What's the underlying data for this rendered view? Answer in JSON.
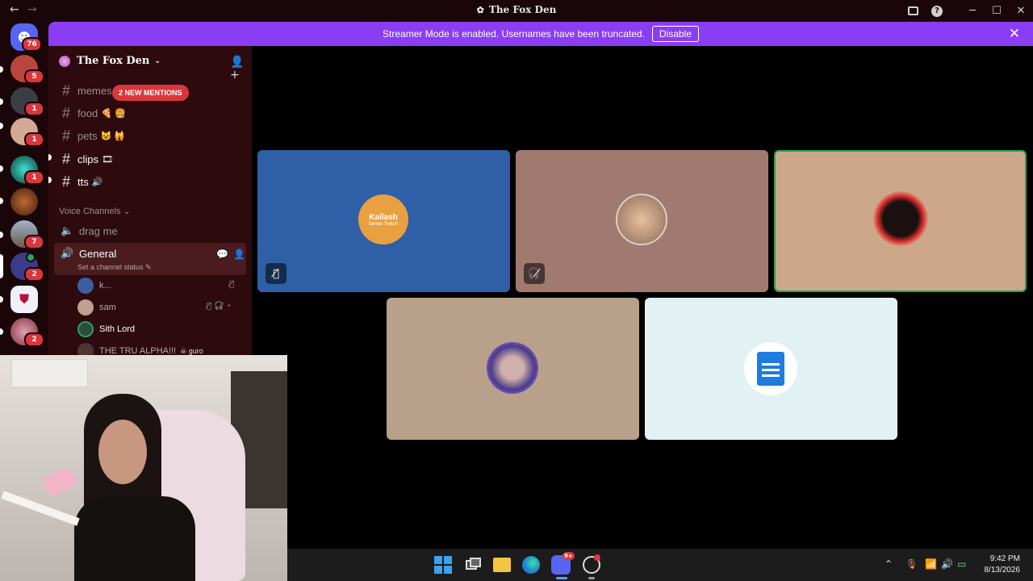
{
  "window": {
    "title": "The Fox Den",
    "back": "←",
    "forward": "→"
  },
  "banner": {
    "text": "Streamer Mode is enabled. Usernames have been truncated.",
    "button": "Disable",
    "close": "✕"
  },
  "servers": [
    {
      "badge": "76",
      "color": "#5865f2"
    },
    {
      "badge": "5",
      "color": "#b8463f"
    },
    {
      "badge": "1",
      "color": "#3a3d44"
    },
    {
      "badge": "1",
      "color": "#d4a896"
    },
    {
      "badge": "1",
      "color": "#1b6d6a"
    },
    {
      "badge": "",
      "color": "#6b3a1e"
    },
    {
      "badge": "7",
      "color": "#7b8ca1"
    },
    {
      "badge": "2",
      "color": "#3b3b8a"
    },
    {
      "badge": "",
      "color": "#e8e8f0"
    },
    {
      "badge": "2",
      "color": "#b07080"
    }
  ],
  "guild": {
    "name": "The Fox Den",
    "chevron": "⌄"
  },
  "channels": [
    {
      "name": "memes",
      "emoji": "",
      "unread": false
    },
    {
      "name": "food",
      "emoji": "🍕 🍔",
      "unread": false
    },
    {
      "name": "pets",
      "emoji": "😺 🙀",
      "unread": false
    },
    {
      "name": "clips",
      "emoji": "🎞",
      "unread": true
    },
    {
      "name": "tts",
      "emoji": "🔊",
      "unread": true
    }
  ],
  "mentions_pill": "2 NEW MENTIONS",
  "voice_category": "Voice Channels",
  "voice_channels": {
    "drag_me": "drag me",
    "general": "General",
    "status": "Set a channel status"
  },
  "voice_users": [
    {
      "name": "k...",
      "color": "#3d5fa1"
    },
    {
      "name": "sam",
      "color": "#c0a090"
    },
    {
      "name": "Sith Lord",
      "color": "#2e4a3e"
    },
    {
      "name": "THE TRU ALPHA!!!",
      "color": "#4a3530",
      "tag": "guro"
    }
  ],
  "tiles": [
    {
      "label": "Kailash",
      "sub": "farmer Twitch",
      "bg": "#2f5fa6"
    },
    {
      "bg": "#a07a6e"
    },
    {
      "bg": "#cda789"
    },
    {
      "bg": "#b8a08a"
    },
    {
      "bg": "#e2f1f3"
    }
  ],
  "taskbar": {
    "badge": "9+"
  },
  "clock": {
    "time": "9:42 PM",
    "date": "8/13/2026"
  }
}
